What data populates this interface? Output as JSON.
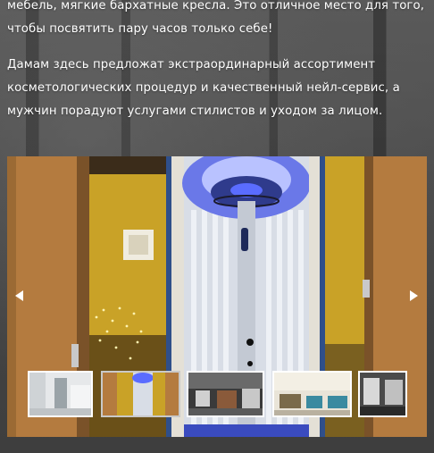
{
  "intro": {
    "line1": "мебель, мягкие бархатные кресла. Это отличное место для того,",
    "line2": "чтобы посвятить пару часов только себе!",
    "paragraph2": "Дамам здесь предложат экстраординарный ассортимент косметологических процедур и качественный нейл-сервис, а мужчин порадуют услугами стилистов и уходом за лицом."
  },
  "gallery": {
    "active_index": 1,
    "slide_icon": "tanning-booth-photo",
    "prev_icon": "chevron-left-icon",
    "next_icon": "chevron-right-icon",
    "thumbnails": [
      {
        "icon": "salon-room-photo"
      },
      {
        "icon": "tanning-booth-photo"
      },
      {
        "icon": "salon-interior-photo"
      },
      {
        "icon": "lounge-photo"
      },
      {
        "icon": "hair-station-photo"
      }
    ]
  },
  "colors": {
    "page_bg": "#4a4a4a",
    "text": "#ffffff",
    "wall_yellow": "#c9a227",
    "wood": "#b0793c",
    "booth_light": "#5a6cff"
  }
}
